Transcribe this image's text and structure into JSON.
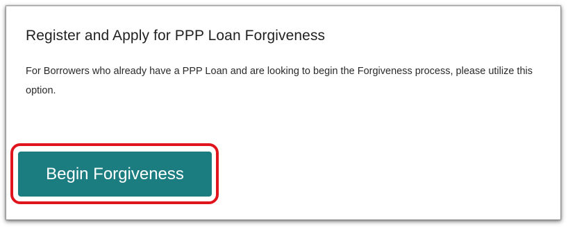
{
  "card": {
    "title": "Register and Apply for PPP Loan Forgiveness",
    "description": "For Borrowers who already have a PPP Loan and are looking to begin the Forgiveness process, please utilize this option.",
    "button_label": "Begin Forgiveness"
  },
  "colors": {
    "button_background": "#1b7d80",
    "button_text": "#ffffff",
    "highlight_outline": "#e0141c",
    "card_border": "#9a9a9a"
  }
}
